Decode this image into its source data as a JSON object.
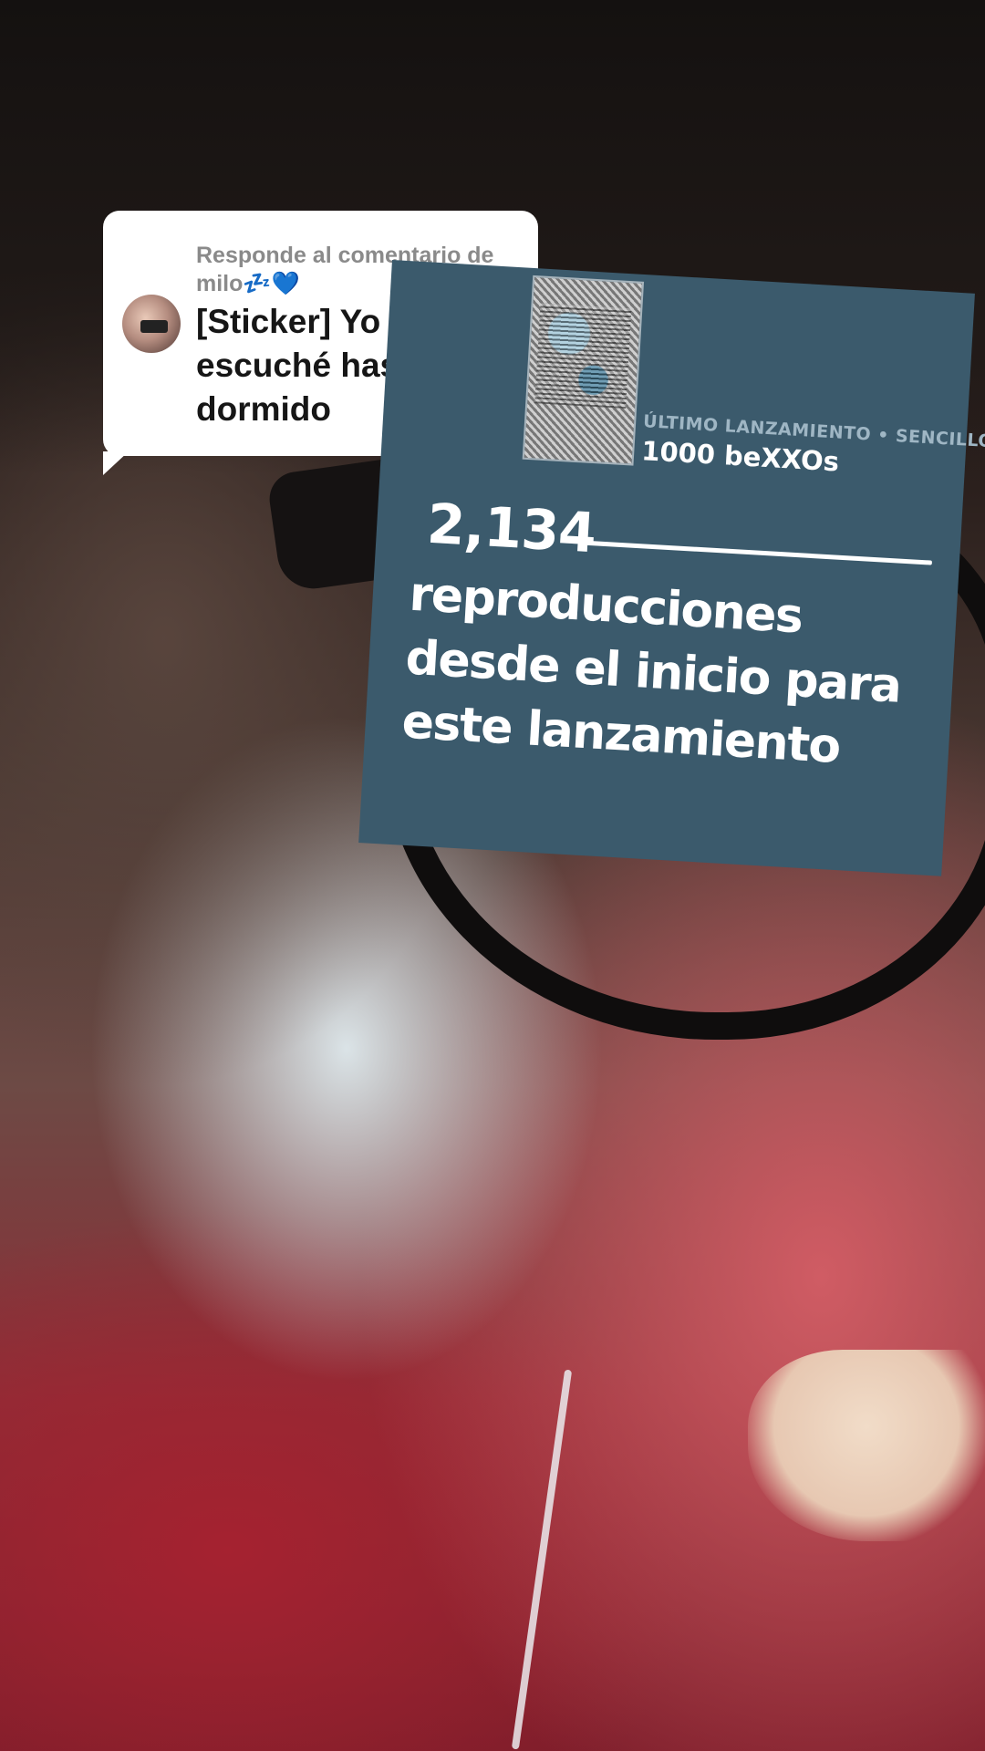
{
  "reply": {
    "header": "Responde al comentario de milo💤💙",
    "text": "[Sticker] Yo la escuché hasta dormido"
  },
  "release": {
    "subtitle": "ÚLTIMO LANZAMIENTO • SENCILLO",
    "title": "1000 beXXOs",
    "play_count": "2,134",
    "caption": "reproducciones desde el inicio para este lanzamiento"
  },
  "colors": {
    "card_background": "#3b5a6c",
    "bubble_background": "#ffffff"
  }
}
